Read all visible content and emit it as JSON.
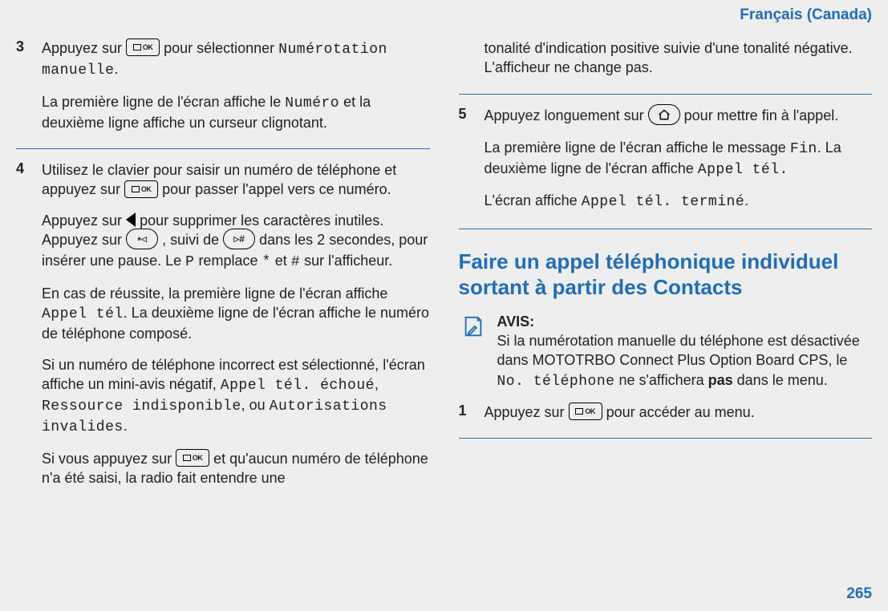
{
  "header": {
    "language": "Français (Canada)"
  },
  "page_number": "265",
  "left": {
    "step3": {
      "num": "3",
      "p1a": "Appuyez sur ",
      "p1b": " pour sélectionner ",
      "p1_code": "Numérotation manuelle",
      "p1c": ".",
      "p2a": "La première ligne de l'écran affiche le ",
      "p2_code": "Numéro",
      "p2b": " et la deuxième ligne affiche un curseur clignotant."
    },
    "step4": {
      "num": "4",
      "p1a": "Utilisez le clavier pour saisir un numéro de téléphone et appuyez sur ",
      "p1b": " pour passer l'appel vers ce numéro.",
      "p2a": "Appuyez sur ",
      "p2b": " pour supprimer les caractères inutiles. Appuyez sur ",
      "p2c": " , suivi de ",
      "p2d": " dans les 2 secondes, pour insérer une pause. Le ",
      "p2_codeP": "P",
      "p2e": " remplace ",
      "p2_codeStar": "*",
      "p2f": " et ",
      "p2_codeHash": "#",
      "p2g": " sur l'afficheur.",
      "p3a": "En cas de réussite, la première ligne de l'écran affiche ",
      "p3_code1": "Appel tél",
      "p3b": ". La deuxième ligne de l'écran affiche le numéro de téléphone composé.",
      "p4a": "Si un numéro de téléphone incorrect est sélectionné, l'écran affiche un mini-avis négatif, ",
      "p4_code1": "Appel tél. échoué",
      "p4b": ", ",
      "p4_code2": "Ressource indisponible",
      "p4c": ", ou ",
      "p4_code3": "Autorisations invalides",
      "p4d": ".",
      "p5a": "Si vous appuyez sur ",
      "p5b": " et qu'aucun numéro de téléphone n'a été saisi, la radio fait entendre une"
    }
  },
  "right": {
    "cont": "tonalité d'indication positive suivie d'une tonalité négative. L'afficheur ne change pas.",
    "step5": {
      "num": "5",
      "p1a": "Appuyez longuement sur ",
      "p1b": " pour mettre fin à l'appel.",
      "p2a": "La première ligne de l'écran affiche le message ",
      "p2_code1": "Fin",
      "p2b": ". La deuxième ligne de l'écran affiche ",
      "p2_code2": "Appel tél.",
      "p3a": "L'écran affiche ",
      "p3_code": "Appel tél. terminé",
      "p3b": "."
    },
    "section_title": "Faire un appel téléphonique individuel sortant à partir des Contacts",
    "notice": {
      "title": "AVIS:",
      "body_a": "Si la numérotation manuelle du téléphone est désactivée dans MOTOTRBO Connect Plus Option Board CPS, le ",
      "body_code": "No. téléphone",
      "body_b": " ne s'affichera ",
      "body_bold": "pas",
      "body_c": " dans le menu."
    },
    "step1": {
      "num": "1",
      "p1a": "Appuyez sur ",
      "p1b": " pour accéder au menu."
    }
  },
  "icons": {
    "ok": "OK",
    "star": "*",
    "hash": "#"
  }
}
